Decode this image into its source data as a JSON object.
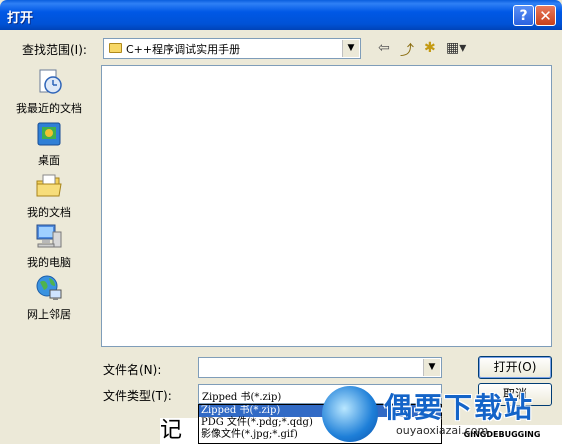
{
  "window": {
    "title": "打开",
    "help_label": "?",
    "close_label": "✕"
  },
  "lookin": {
    "label": "查找范围(I):",
    "value": "C++程序调试实用手册",
    "arrow": "▼"
  },
  "toolbar": {
    "back": "⇦",
    "up": "⤴",
    "newfolder": "✱",
    "views": "▦▾"
  },
  "places": [
    {
      "label": "我最近的文档",
      "icon": "recent-documents-icon"
    },
    {
      "label": "桌面",
      "icon": "desktop-icon"
    },
    {
      "label": "我的文档",
      "icon": "my-documents-icon"
    },
    {
      "label": "我的电脑",
      "icon": "my-computer-icon"
    },
    {
      "label": "网上邻居",
      "icon": "network-places-icon"
    }
  ],
  "filename": {
    "label": "文件名(N):",
    "value": "",
    "arrow": "▼"
  },
  "filetype": {
    "label": "文件类型(T):",
    "value": "Zipped 书(*.zip)",
    "options": [
      "Zipped 书(*.zip)",
      "PDG 文件(*.pdg;*.qdg)",
      "影像文件(*.jpg;*.gif)"
    ]
  },
  "buttons": {
    "open": "打开(O)",
    "cancel": "取消"
  },
  "watermark": {
    "brand": "偶要下载站",
    "url": "ouyaoxiazai.com"
  },
  "background": {
    "fragment_left": "记",
    "fragment_right": "GINGDEBUGGING"
  }
}
